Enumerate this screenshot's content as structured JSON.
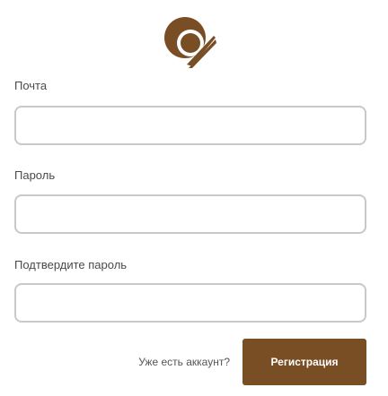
{
  "logo": {
    "icon": "brand-logo-icon",
    "color": "#7a4e24"
  },
  "form": {
    "email": {
      "label": "Почта",
      "value": "",
      "placeholder": ""
    },
    "password": {
      "label": "Пароль",
      "value": "",
      "placeholder": ""
    },
    "confirm_password": {
      "label": "Подтвердите пароль",
      "value": "",
      "placeholder": ""
    }
  },
  "footer": {
    "login_link": "Уже есть аккаунт?",
    "register_button": "Регистрация"
  },
  "colors": {
    "accent": "#7a4e24",
    "input_border": "#c9c9c9",
    "label_text": "#4a4a4a"
  }
}
